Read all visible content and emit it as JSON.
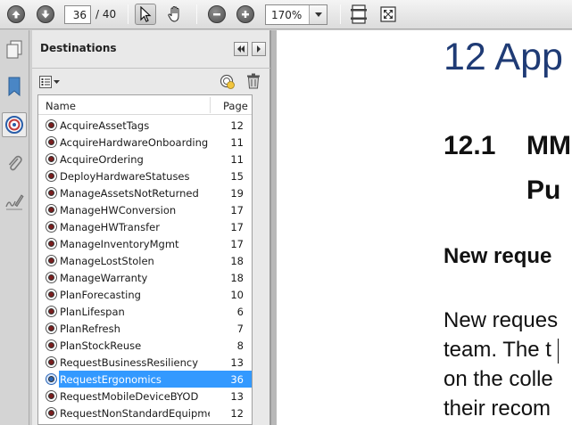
{
  "toolbar": {
    "current_page": "36",
    "page_total": "/ 40",
    "zoom": "170%",
    "icons": [
      "previous-page-icon",
      "next-page-icon",
      "select-tool-icon",
      "hand-tool-icon",
      "zoom-out-icon",
      "zoom-in-icon",
      "fit-page-icon",
      "full-screen-icon"
    ]
  },
  "rail": {
    "icons": [
      "pages-icon",
      "bookmarks-icon",
      "destinations-icon",
      "attachments-icon",
      "signatures-icon"
    ],
    "active": "destinations-icon"
  },
  "panel": {
    "title": "Destinations",
    "columns": {
      "name": "Name",
      "page": "Page"
    },
    "items": [
      {
        "name": "AcquireAssetTags",
        "page": "12"
      },
      {
        "name": "AcquireHardwareOnboarding",
        "page": "11"
      },
      {
        "name": "AcquireOrdering",
        "page": "11"
      },
      {
        "name": "DeployHardwareStatuses",
        "page": "15"
      },
      {
        "name": "ManageAssetsNotReturned",
        "page": "19"
      },
      {
        "name": "ManageHWConversion",
        "page": "17"
      },
      {
        "name": "ManageHWTransfer",
        "page": "17"
      },
      {
        "name": "ManageInventoryMgmt",
        "page": "17"
      },
      {
        "name": "ManageLostStolen",
        "page": "18"
      },
      {
        "name": "ManageWarranty",
        "page": "18"
      },
      {
        "name": "PlanForecasting",
        "page": "10"
      },
      {
        "name": "PlanLifespan",
        "page": "6"
      },
      {
        "name": "PlanRefresh",
        "page": "7"
      },
      {
        "name": "PlanStockReuse",
        "page": "8"
      },
      {
        "name": "RequestBusinessResiliency",
        "page": "13"
      },
      {
        "name": "RequestErgonomics",
        "page": "36"
      },
      {
        "name": "RequestMobileDeviceBYOD",
        "page": "13"
      },
      {
        "name": "RequestNonStandardEquipme...",
        "page": "12"
      }
    ],
    "selected_index": 15
  },
  "document": {
    "heading1": "12 App",
    "heading2_num": "12.1",
    "heading2_line1": "MM",
    "heading2_line2": "Pu",
    "heading3": "New reque",
    "para_lines": [
      "New reques",
      "team. The t",
      "on the colle",
      "their recom"
    ]
  },
  "colors": {
    "selection": "#3399ff",
    "heading_blue": "#1f3b75"
  }
}
